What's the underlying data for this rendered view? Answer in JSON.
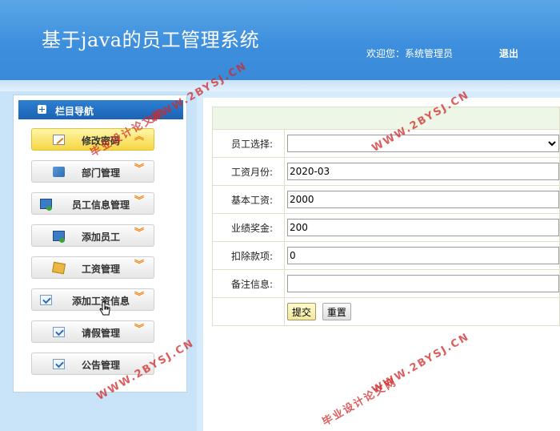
{
  "header": {
    "title": "基于java的员工管理系统",
    "welcome": "欢迎您：系统管理员",
    "logout": "退出"
  },
  "sidebar": {
    "title": "栏目导航",
    "items": [
      {
        "label": "修改密码",
        "icon": "edit-doc-icon",
        "active": true
      },
      {
        "label": "部门管理",
        "icon": "arrow-icon"
      },
      {
        "label": "员工信息管理",
        "icon": "monitor-icon"
      },
      {
        "label": "添加员工",
        "icon": "monitor-icon"
      },
      {
        "label": "工资管理",
        "icon": "box-icon"
      },
      {
        "label": "添加工资信息",
        "icon": "check-icon"
      },
      {
        "label": "请假管理",
        "icon": "check-icon"
      },
      {
        "label": "公告管理",
        "icon": "check-icon"
      }
    ]
  },
  "form": {
    "employee_label": "员工选择:",
    "employee_value": "",
    "month_label": "工资月份:",
    "month_value": "2020-03",
    "base_label": "基本工资:",
    "base_value": "2000",
    "bonus_label": "业绩奖金:",
    "bonus_value": "200",
    "deduct_label": "扣除款项:",
    "deduct_value": "0",
    "note_label": "备注信息:",
    "note_value": "",
    "submit": "提交",
    "reset": "重置"
  },
  "watermarks": {
    "domain": "WWW.2BYSJ.CN",
    "name": "毕业设计论文网"
  },
  "colors": {
    "header": "#3d8fdd",
    "nav_head": "#1b63b5",
    "active": "#f5d642",
    "chevron": "#f08a1a"
  }
}
